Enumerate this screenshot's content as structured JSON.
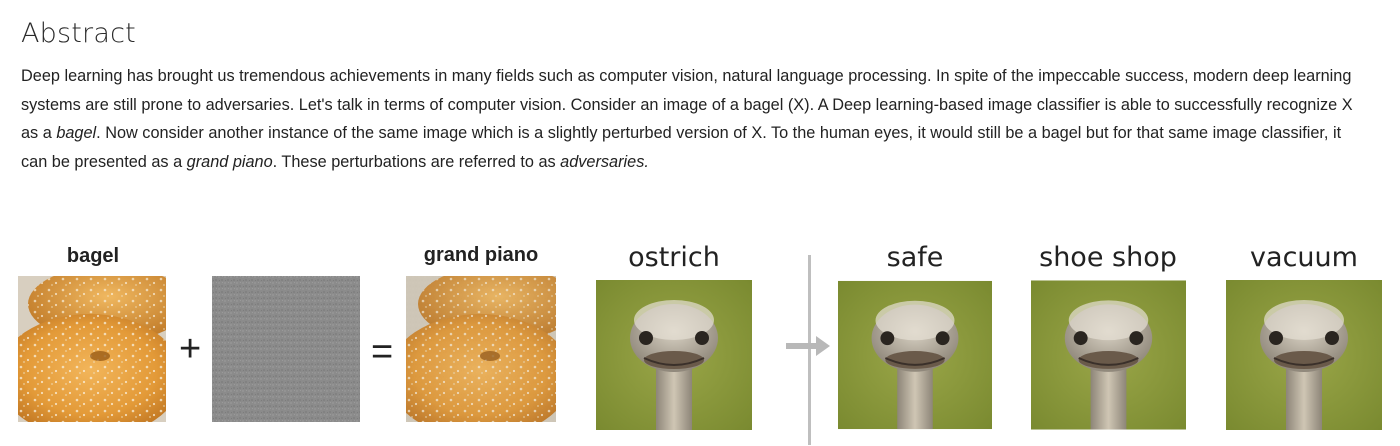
{
  "abstract": {
    "title": "Abstract",
    "body_segments": [
      {
        "text": "Deep learning has brought us tremendous achievements in many fields such as computer vision, natural language processing. In spite of the impeccable success, modern deep learning systems are still prone to adversaries. Let's talk in terms of computer vision. Consider an image of a bagel (X). A Deep learning-based image classifier is able to successfully recognize X as a ",
        "italic": false
      },
      {
        "text": "bagel",
        "italic": true
      },
      {
        "text": ". Now consider another instance of the same image which is a slightly perturbed version of X. To the human eyes, it would still be a bagel but for that same image classifier, it can be presented as a ",
        "italic": false
      },
      {
        "text": "grand piano",
        "italic": true
      },
      {
        "text": ". These perturbations are referred to as ",
        "italic": false
      },
      {
        "text": "adversaries.",
        "italic": true
      }
    ]
  },
  "figure": {
    "bagel_label": "bagel",
    "plus_sign": "+",
    "equals_sign": "=",
    "grand_piano_label": "grand piano",
    "ostrich_label": "ostrich",
    "safe_label": "safe",
    "shoe_shop_label": "shoe shop",
    "vacuum_label": "vacuum",
    "colors": {
      "bagel_crust": "#e0a040",
      "noise_gray": "#8a8a8a",
      "ostrich_bg": "#8a9a3c",
      "divider": "#bfbfbf"
    }
  }
}
